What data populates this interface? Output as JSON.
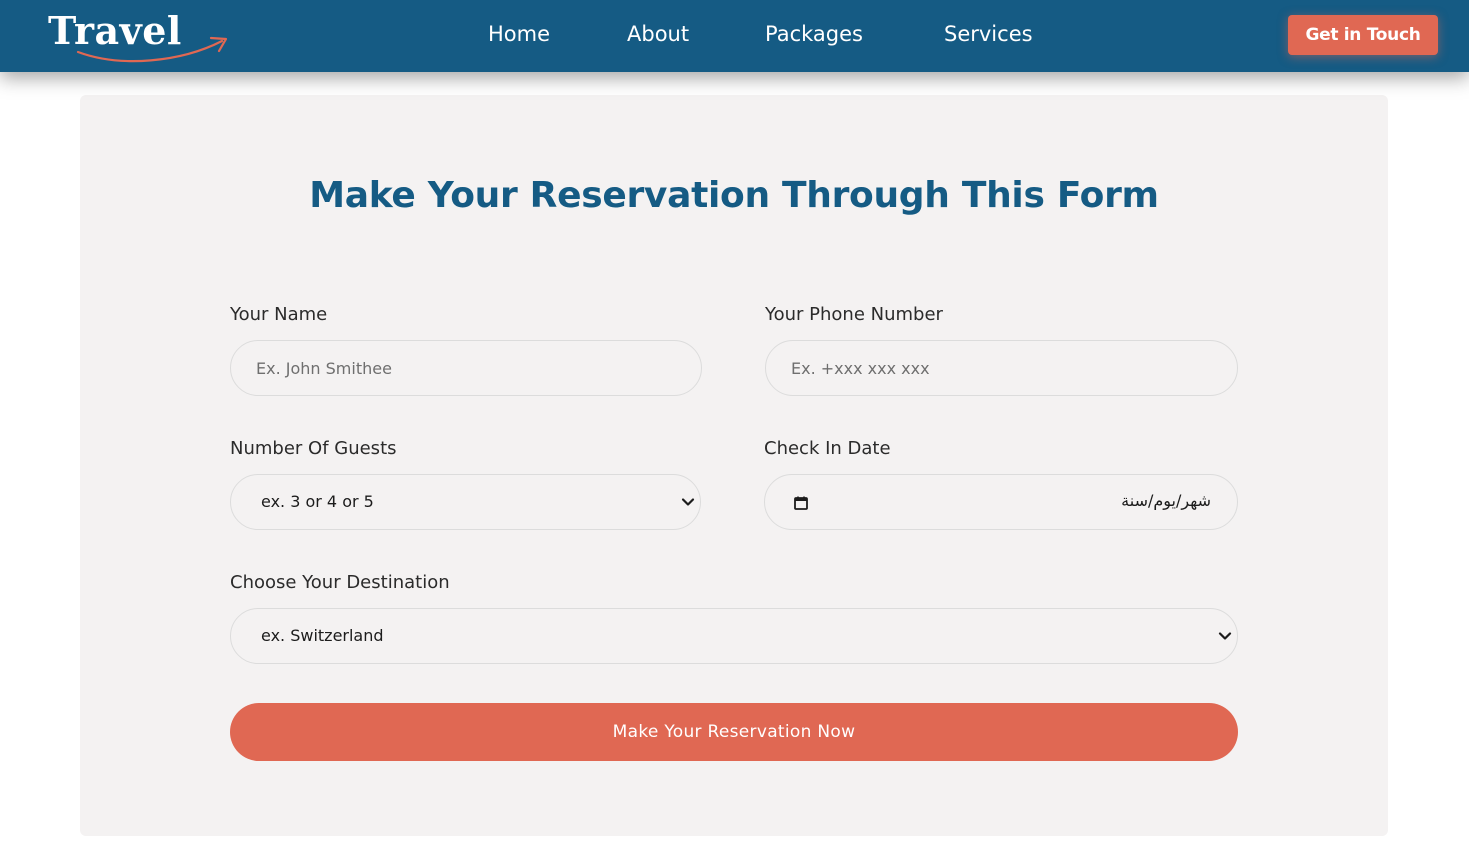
{
  "brand": {
    "name": "Travel"
  },
  "nav": {
    "links": [
      "Home",
      "About",
      "Packages",
      "Services"
    ],
    "cta_label": "Get in Touch"
  },
  "form": {
    "title": "Make Your Reservation Through This Form",
    "name": {
      "label": "Your Name",
      "placeholder": "Ex. John Smithee"
    },
    "phone": {
      "label": "Your Phone Number",
      "placeholder": "Ex. +xxx xxx xxx"
    },
    "guests": {
      "label": "Number Of Guests",
      "selected": "ex. 3 or 4 or 5"
    },
    "checkin": {
      "label": "Check In Date",
      "value": "شهر/يوم/سنة"
    },
    "destination": {
      "label": "Choose Your Destination",
      "selected": "ex. Switzerland"
    },
    "submit_label": "Make Your Reservation Now"
  },
  "icons": {
    "logo_swoosh": "arrow-swoosh-icon",
    "select_chevron": "chevron-down-icon",
    "date_picker": "calendar-icon"
  },
  "colors": {
    "primary": "#155b84",
    "accent": "#e06853",
    "card_bg": "#f4f2f2"
  }
}
